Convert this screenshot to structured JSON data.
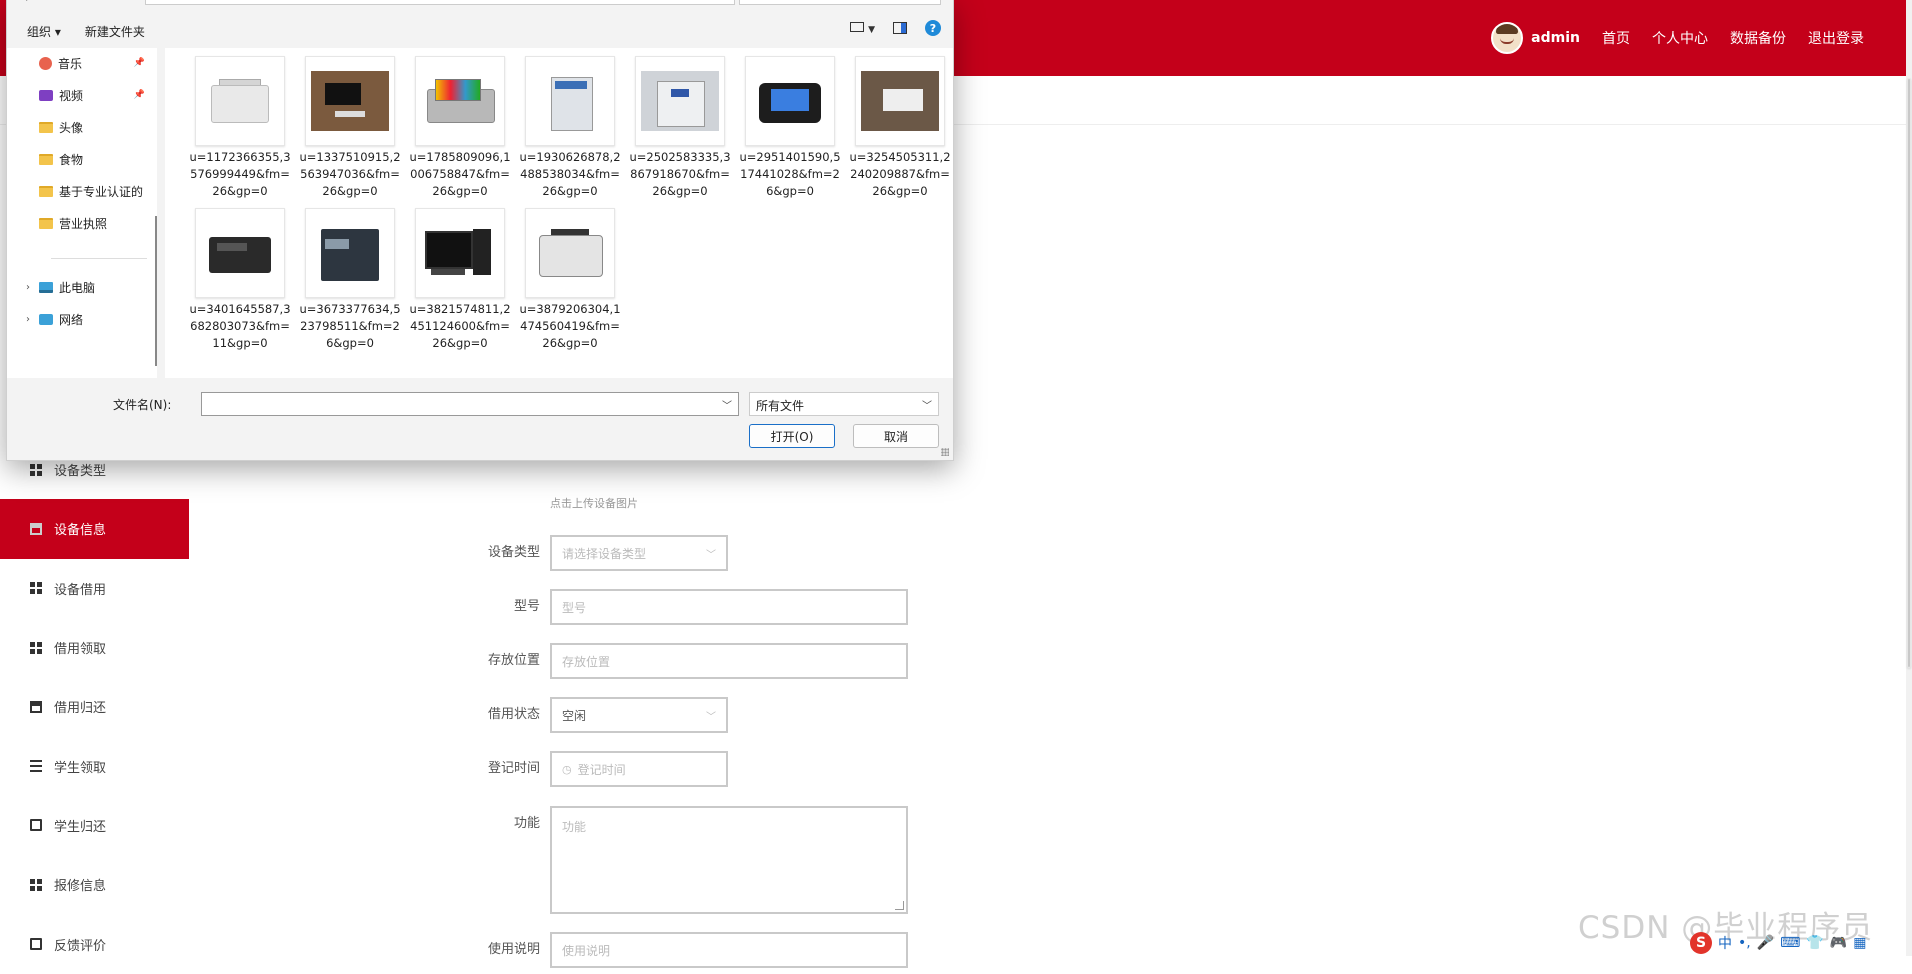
{
  "topnav": {
    "username": "admin",
    "links": [
      "首页",
      "个人中心",
      "数据备份",
      "退出登录"
    ]
  },
  "sidebar": {
    "items": [
      {
        "label": "设备类型",
        "icon": "grid-icon",
        "active": false
      },
      {
        "label": "设备信息",
        "icon": "device-icon",
        "active": true
      },
      {
        "label": "设备借用",
        "icon": "grid-icon",
        "active": false
      },
      {
        "label": "借用领取",
        "icon": "grid-icon",
        "active": false
      },
      {
        "label": "借用归还",
        "icon": "device-icon",
        "active": false
      },
      {
        "label": "学生领取",
        "icon": "list-icon",
        "active": false
      },
      {
        "label": "学生归还",
        "icon": "clipboard-icon",
        "active": false
      },
      {
        "label": "报修信息",
        "icon": "grid-icon",
        "active": false
      },
      {
        "label": "反馈评价",
        "icon": "clipboard-icon",
        "active": false
      }
    ]
  },
  "form": {
    "upload_hint": "点击上传设备图片",
    "type_label": "设备类型",
    "type_placeholder": "请选择设备类型",
    "model_label": "型号",
    "model_placeholder": "型号",
    "location_label": "存放位置",
    "location_placeholder": "存放位置",
    "status_label": "借用状态",
    "status_value": "空闲",
    "date_label": "登记时间",
    "date_placeholder": "登记时间",
    "function_label": "功能",
    "function_placeholder": "功能",
    "usage_label": "使用说明",
    "usage_placeholder": "使用说明"
  },
  "dialog": {
    "toolbar": {
      "organize": "组织 ▾",
      "new_folder": "新建文件夹"
    },
    "nav": [
      {
        "label": "音乐",
        "icon": "music-icon",
        "pinned": true
      },
      {
        "label": "视频",
        "icon": "video-icon",
        "pinned": true
      },
      {
        "label": "头像",
        "icon": "folder-icon",
        "pinned": false
      },
      {
        "label": "食物",
        "icon": "folder-icon",
        "pinned": false
      },
      {
        "label": "基于专业认证的",
        "icon": "folder-icon",
        "pinned": false
      },
      {
        "label": "营业执照",
        "icon": "folder-icon",
        "pinned": false
      },
      {
        "label": "此电脑",
        "icon": "computer-icon",
        "pinned": false
      },
      {
        "label": "网络",
        "icon": "network-icon",
        "pinned": false
      }
    ],
    "files": [
      {
        "name": "u=1172366355,3576999449&fm=26&gp=0",
        "icon": "copier"
      },
      {
        "name": "u=1337510915,2563947036&fm=26&gp=0",
        "icon": "desk"
      },
      {
        "name": "u=1785809096,1006758847&fm=26&gp=0",
        "icon": "colorprinter"
      },
      {
        "name": "u=1930626878,2488538034&fm=26&gp=0",
        "icon": "mfp"
      },
      {
        "name": "u=2502583335,3867918670&fm=26&gp=0",
        "icon": "bigcopier"
      },
      {
        "name": "u=2951401590,517441028&fm=26&gp=0",
        "icon": "pos"
      },
      {
        "name": "u=3254505311,2240209887&fm=26&gp=0",
        "icon": "office"
      },
      {
        "name": "u=3401645587,3682803073&fm=11&gp=0",
        "icon": "laser"
      },
      {
        "name": "u=3673377634,523798511&fm=26&gp=0",
        "icon": "prod"
      },
      {
        "name": "u=3821574811,2451124600&fm=26&gp=0",
        "icon": "pc2"
      },
      {
        "name": "u=3879206304,1474560419&fm=26&gp=0",
        "icon": "counter"
      }
    ],
    "filename_label": "文件名(N):",
    "filename_value": "",
    "filetype": "所有文件",
    "open_label": "打开(O)",
    "cancel_label": "取消"
  },
  "watermark": "CSDN @毕业程序员",
  "ime": {
    "lang": "中",
    "punct": "•,"
  }
}
